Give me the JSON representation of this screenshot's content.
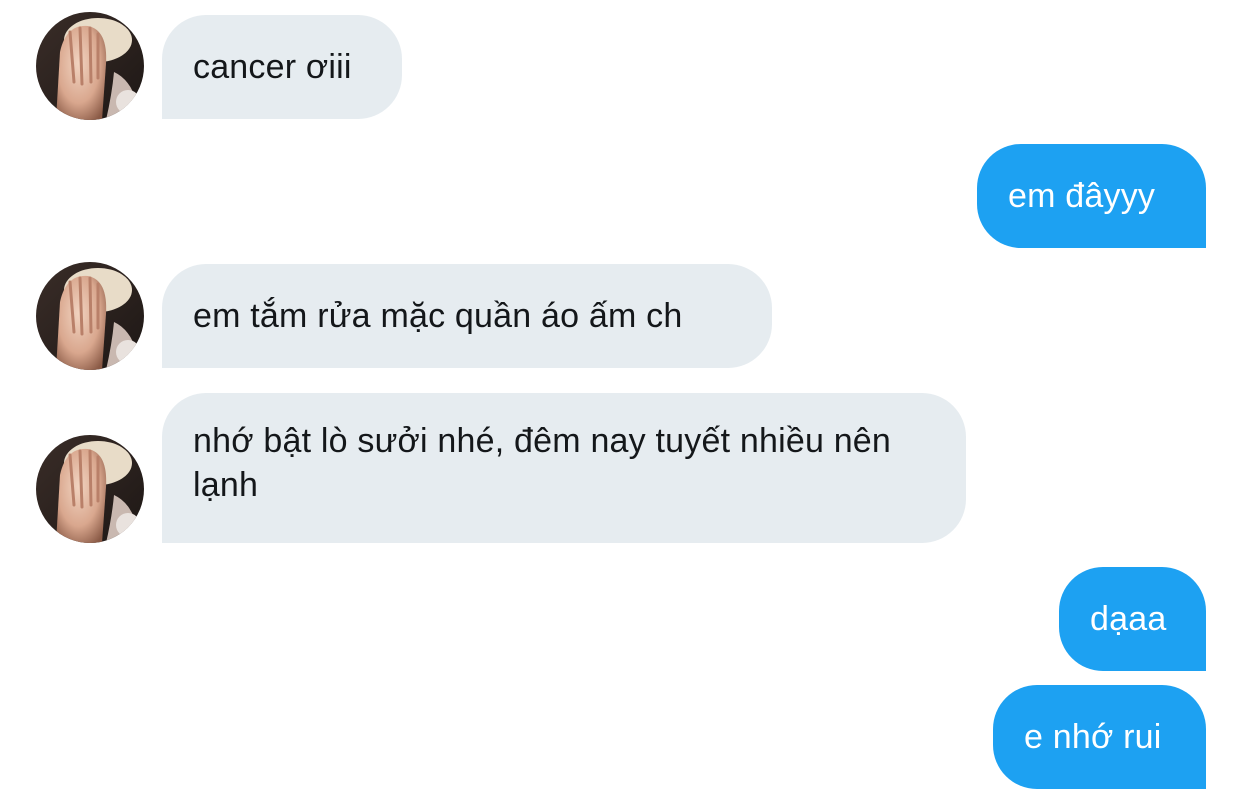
{
  "conversation": {
    "messages": [
      {
        "direction": "incoming",
        "text": "cancer ơiii"
      },
      {
        "direction": "outgoing",
        "text": "em đâyyy"
      },
      {
        "direction": "incoming",
        "text": "em tắm rửa mặc quần áo ấm ch"
      },
      {
        "direction": "incoming",
        "text": "nhớ bật lò sưởi nhé, đêm nay tuyết nhiều nên lạnh"
      },
      {
        "direction": "outgoing",
        "text": "dạaa"
      },
      {
        "direction": "outgoing",
        "text": "e nhớ rui"
      }
    ]
  },
  "colors": {
    "incoming_bubble": "#e6ecf0",
    "outgoing_bubble": "#1da1f2",
    "incoming_text": "#14171a",
    "outgoing_text": "#ffffff"
  },
  "icons": {
    "avatar": "avatar-photo"
  }
}
